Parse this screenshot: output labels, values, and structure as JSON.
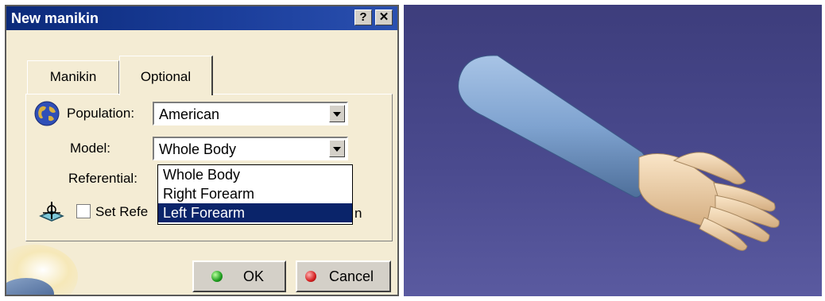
{
  "dialog": {
    "title": "New manikin",
    "help_glyph": "?",
    "close_glyph": "✕",
    "tabs": [
      {
        "label": "Manikin",
        "active": false
      },
      {
        "label": "Optional",
        "active": true
      }
    ],
    "population": {
      "label": "Population:",
      "value": "American",
      "icon": "globe-icon"
    },
    "model": {
      "label": "Model:",
      "value": "Whole Body",
      "options": [
        "Whole Body",
        "Right Forearm",
        "Left Forearm"
      ],
      "highlighted_option": "Left Forearm"
    },
    "referential": {
      "label": "Referential:"
    },
    "set_referential": {
      "label_visible": "Set Refe",
      "label_tail": "n",
      "checked": false,
      "icon": "compass-plane-icon"
    },
    "buttons": {
      "ok": "OK",
      "cancel": "Cancel"
    }
  },
  "viewport": {
    "content": "forearm-and-hand-model",
    "background_color": "#44448a",
    "forearm_color": "#7fa3d0",
    "hand_color": "#f0d2a8"
  }
}
